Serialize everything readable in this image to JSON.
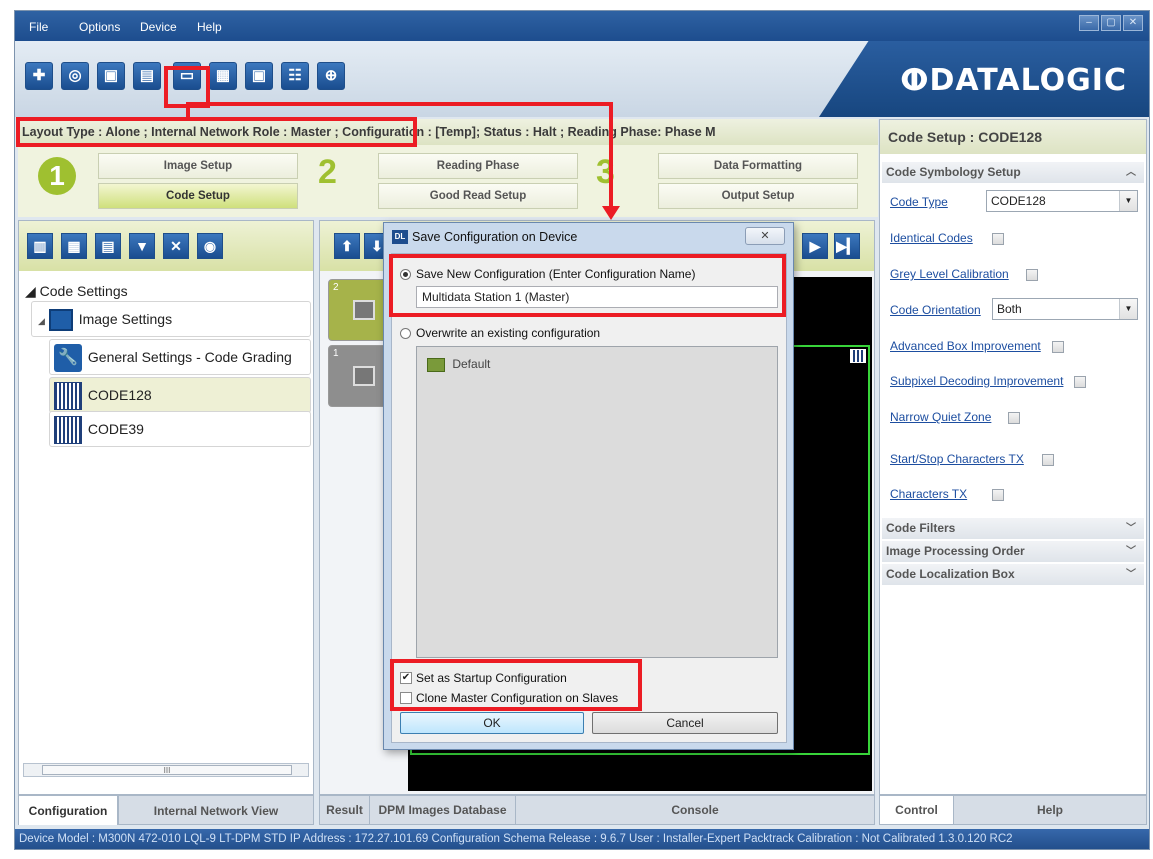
{
  "menu": [
    "File",
    "Options",
    "Device",
    "Help"
  ],
  "window_controls": {
    "min": "–",
    "max": "▢",
    "close": "✕"
  },
  "toolbar": {
    "buttons": [
      "target-icon",
      "camera-icon",
      "go-online-icon",
      "save-on-device-icon",
      "receive-icon",
      "save-to-pc-icon",
      "device-icon",
      "monitor-icon",
      "crosshair-icon"
    ],
    "logo": "ⵀDATALOGIC"
  },
  "infobar": {
    "text": "Layout Type : Alone ; Internal Network Role : Master ; Configuration : [Temp]; Status : Halt ; Reading Phase: Phase M"
  },
  "steps": {
    "step1": "1",
    "step2": "2",
    "step3": "3",
    "image_setup": "Image Setup",
    "code_setup": "Code Setup",
    "reading_phase": "Reading Phase",
    "good_read_setup": "Good Read Setup",
    "data_formatting": "Data Formatting",
    "output_setup": "Output Setup"
  },
  "tree": {
    "root": "◢ Code Settings",
    "image_settings": "Image Settings",
    "general_settings": "General Settings - Code Grading",
    "code128": "CODE128",
    "code39": "CODE39"
  },
  "scroll_grip": "III",
  "left_tabs": {
    "configuration": "Configuration",
    "internal_network": "Internal Network View"
  },
  "center": {
    "thumb2": "2",
    "thumb1": "1"
  },
  "center_tabs": {
    "result": "Result",
    "dpm": "DPM Images Database",
    "console": "Console"
  },
  "right": {
    "title": "Code Setup : CODE128",
    "symbology_section": "Code Symbology Setup",
    "code_type_label": "Code Type",
    "code_type_value": "CODE128",
    "identical_codes": "Identical Codes",
    "grey_level": "Grey Level Calibration",
    "code_orientation": "Code Orientation",
    "code_orientation_value": "Both",
    "advanced_box": "Advanced Box Improvement",
    "subpixel": "Subpixel Decoding Improvement",
    "narrow_quiet": "Narrow Quiet Zone",
    "start_stop": "Start/Stop Characters TX",
    "characters_tx": "Characters TX",
    "code_filters": "Code Filters",
    "image_processing": "Image Processing Order",
    "code_localization": "Code Localization Box"
  },
  "right_tabs": {
    "control": "Control",
    "help": "Help"
  },
  "status_bar": "Device Model : M300N 472-010 LQL-9 LT-DPM STD   IP Address : 172.27.101.69   Configuration Schema Release : 9.6.7   User : Installer-Expert   Packtrack Calibration : Not Calibrated 1.3.0.120 RC2",
  "dialog": {
    "app_badge": "DL",
    "title": "Save Configuration on Device",
    "close": "✕",
    "save_new_label": "Save New Configuration (Enter Configuration Name)",
    "config_name": "Multidata Station 1 (Master)",
    "overwrite_label": "Overwrite an existing configuration",
    "existing": [
      "Default"
    ],
    "startup_label": "Set as Startup Configuration",
    "startup_checked": true,
    "clone_label": "Clone Master Configuration on Slaves",
    "clone_checked": false,
    "ok": "OK",
    "cancel": "Cancel"
  },
  "colors": {
    "annotation_red": "#ec1c24",
    "brand_blue": "#1d4d8e",
    "accent_green": "#9fc030"
  }
}
